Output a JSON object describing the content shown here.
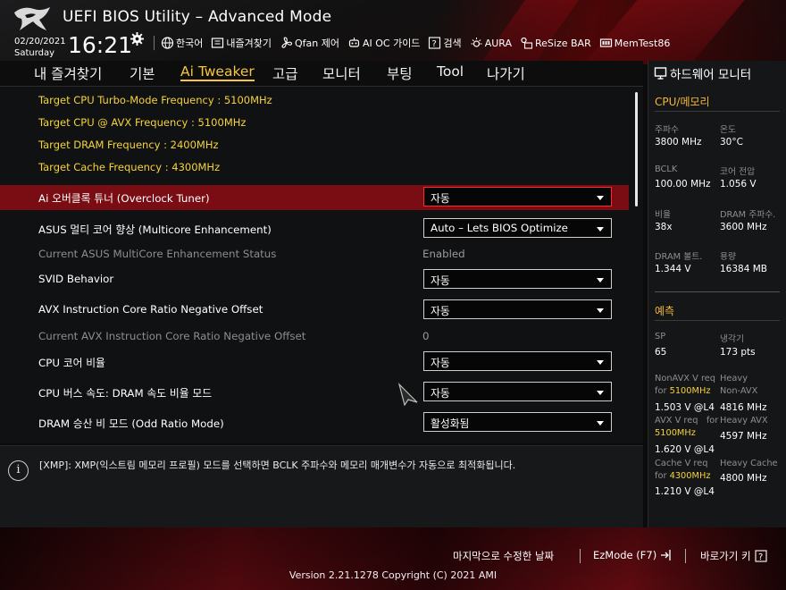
{
  "header": {
    "title": "UEFI BIOS Utility – Advanced Mode",
    "date": "02/20/2021",
    "day": "Saturday",
    "time": "16:21",
    "toolbar": [
      {
        "icon": "globe-icon",
        "label": "한국어"
      },
      {
        "icon": "bookmark-icon",
        "label": "내즐겨찾기"
      },
      {
        "icon": "fan-icon",
        "label": "Qfan 제어"
      },
      {
        "icon": "oc-guide-icon",
        "label": "AI OC 가이드"
      },
      {
        "icon": "search-icon",
        "label": "검색"
      },
      {
        "icon": "aura-icon",
        "label": "AURA"
      },
      {
        "icon": "resize-bar-icon",
        "label": "ReSize BAR"
      },
      {
        "icon": "memtest-icon",
        "label": "MemTest86"
      }
    ]
  },
  "nav": {
    "tabs": [
      "내 즐겨찾기",
      "기본",
      "Ai Tweaker",
      "고급",
      "모니터",
      "부팅",
      "Tool",
      "나가기"
    ],
    "active": "Ai Tweaker"
  },
  "main": {
    "info_lines": [
      "Target CPU Turbo-Mode Frequency : 5100MHz",
      "Target CPU @ AVX Frequency : 5100MHz",
      "Target DRAM Frequency : 2400MHz",
      "Target Cache Frequency : 4300MHz"
    ],
    "rows": [
      {
        "label": "Ai 오버클록 튜너 (Overclock Tuner)",
        "value": "자동",
        "type": "select",
        "highlighted": true
      },
      {
        "label": "ASUS 멀티 코어 향상 (Multicore Enhancement)",
        "value": "Auto – Lets BIOS Optimize",
        "type": "select"
      },
      {
        "label": "Current ASUS MultiCore Enhancement Status",
        "value": "Enabled",
        "type": "text"
      },
      {
        "label": "SVID Behavior",
        "value": "자동",
        "type": "select"
      },
      {
        "label": "AVX Instruction Core Ratio Negative Offset",
        "value": "자동",
        "type": "select"
      },
      {
        "label": "Current AVX Instruction Core Ratio Negative Offset",
        "value": "0",
        "type": "text"
      },
      {
        "label": "CPU 코어 비율",
        "value": "자동",
        "type": "select"
      },
      {
        "label": "CPU 버스 속도: DRAM 속도 비율 모드",
        "value": "자동",
        "type": "select"
      },
      {
        "label": "DRAM 승산 비 모드 (Odd Ratio Mode)",
        "value": "활성화됨",
        "type": "select"
      }
    ]
  },
  "info_bar": {
    "text": "[XMP]: XMP(익스트림 메모리 프로필) 모드를 선택하면 BCLK 주파수와 메모리 매개변수가 자동으로 최적화됩니다."
  },
  "hw_monitor": {
    "title": "하드웨어 모니터",
    "cpu_mem": {
      "title": "CPU/메모리",
      "items": [
        {
          "key": "주파수",
          "value": "3800 MHz"
        },
        {
          "key": "온도",
          "value": "30°C"
        },
        {
          "key": "BCLK",
          "value": "100.00 MHz"
        },
        {
          "key": "코어 전압",
          "value": "1.056 V"
        },
        {
          "key": "비율",
          "value": "38x"
        },
        {
          "key": "DRAM 주파수.",
          "value": "3600 MHz"
        },
        {
          "key": "DRAM 볼트.",
          "value": "1.344 V"
        },
        {
          "key": "용량",
          "value": "16384 MB"
        }
      ]
    },
    "prediction": {
      "title": "예측",
      "sp_key": "SP",
      "sp_value": "65",
      "cooler_key": "냉각기",
      "cooler_value": "173 pts",
      "nonavx_req_a": "NonAVX V req",
      "nonavx_req_b": "for ",
      "nonavx_freq": "5100MHz",
      "nonavx_v": "1.503 V @L4",
      "nonavx_heavy_a": "Heavy",
      "nonavx_heavy_b": "Non-AVX",
      "nonavx_heavy_v": "4816 MHz",
      "avx_req_a": "AVX V req   for ",
      "avx_freq": "5100MHz",
      "avx_v": "1.620 V @L4",
      "avx_heavy": "Heavy AVX",
      "avx_heavy_v": "4597 MHz",
      "cache_req_a": "Cache V req",
      "cache_req_b": "for ",
      "cache_freq": "4300MHz",
      "cache_v": "1.210 V @L4",
      "cache_heavy": "Heavy Cache",
      "cache_heavy_v": "4800 MHz"
    }
  },
  "footer": {
    "last_modified": "마지막으로 수정한 날짜",
    "ezmode": "EzMode (F7)",
    "hotkeys": "바로가기 키",
    "version": "Version 2.21.1278 Copyright (C) 2021 AMI"
  },
  "colors": {
    "accent": "#f5c542",
    "highlight": "#7a0d13",
    "section": "#f5b63a"
  }
}
